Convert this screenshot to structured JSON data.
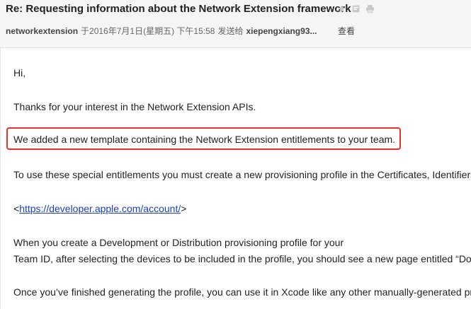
{
  "header": {
    "subject": "Re: Requesting information about the Network Extension framework",
    "sender": "networkextension",
    "date": "于2016年7月1日(星期五) 下午15:58",
    "sent_to_label": "发送给",
    "recipient": "xiepengxiang93...",
    "view_label": "查看"
  },
  "body": {
    "greeting": "Hi,",
    "thanks": "Thanks for your interest in the Network Extension APIs.",
    "highlight": "We added a new template containing the Network Extension entitlements to your team.",
    "instructions": "To use these special entitlements you must create a new provisioning profile in the Certificates, Identifiers",
    "link_open": "<",
    "link_url": "https://developer.apple.com/account/",
    "link_close": ">",
    "create_line1": "When you create a Development or Distribution provisioning profile for your",
    "create_line2": "Team ID, after selecting the devices to be included in the profile, you should see a new page entitled “Do",
    "finished": "Once you’ve finished generating the profile, you can use it in Xcode like any other manually-generated pr"
  },
  "colors": {
    "highlight_border": "#e8322a",
    "link": "#1a3fbf"
  },
  "icons": [
    "star-icon",
    "archive-icon",
    "print-icon"
  ]
}
